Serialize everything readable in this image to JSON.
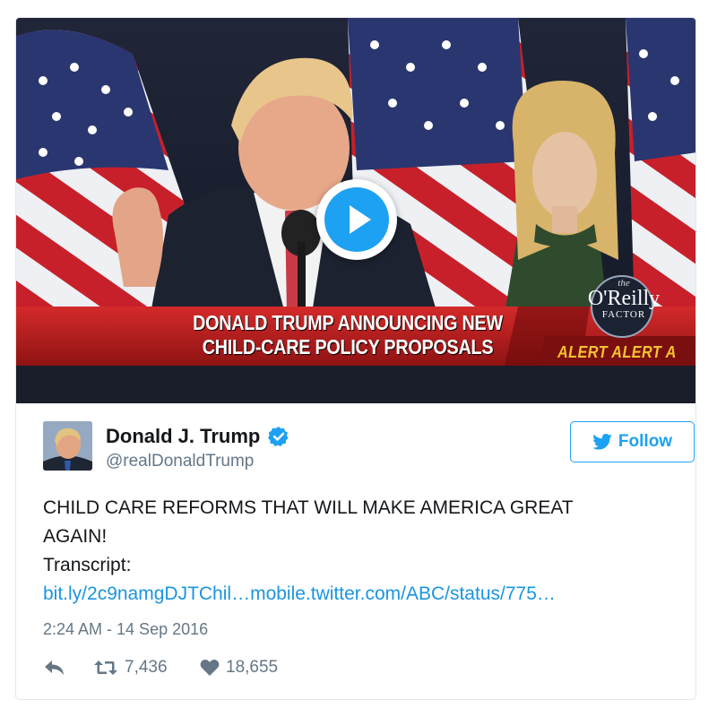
{
  "video": {
    "chyron_line1": "DONALD TRUMP ANNOUNCING NEW",
    "chyron_line2": "CHILD-CARE POLICY PROPOSALS",
    "alert_text": "ALERT ALERT A",
    "logo_the": "the",
    "logo_name": "O'Reilly",
    "logo_factor": "FACTOR"
  },
  "author": {
    "display_name": "Donald J. Trump",
    "handle": "@realDonaldTrump",
    "verified": true
  },
  "follow_button": {
    "label": "Follow",
    "icon": "twitter-bird-icon"
  },
  "tweet": {
    "line1": "CHILD CARE REFORMS THAT WILL MAKE AMERICA GREAT",
    "line2": "AGAIN!",
    "line3": "Transcript:",
    "link": "bit.ly/2c9namgDJTChil…mobile.twitter.com/ABC/status/775…",
    "timestamp": "2:24 AM - 14 Sep 2016"
  },
  "actions": {
    "reply_icon": "reply-icon",
    "retweet_icon": "retweet-icon",
    "retweet_count": "7,436",
    "like_icon": "heart-icon",
    "like_count": "18,655"
  },
  "colors": {
    "accent": "#1da1f2",
    "link": "#1b95e0",
    "muted": "#657786",
    "chyron_red": "#b01c1c",
    "alert_yellow": "#f5c232"
  }
}
